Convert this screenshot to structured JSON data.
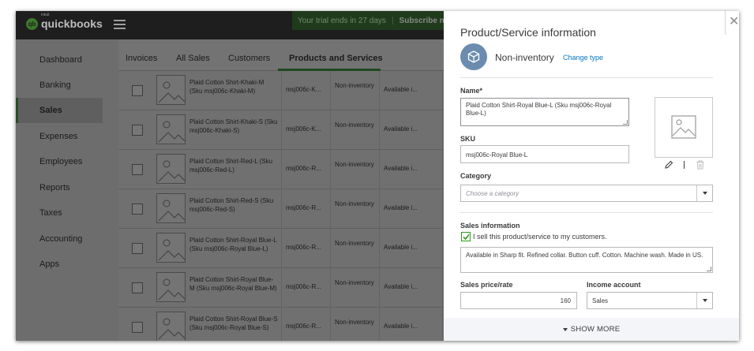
{
  "header": {
    "logo_small": "intuit",
    "logo_text": "quickbooks",
    "trial_text": "Your trial ends in 27 days",
    "subscribe": "Subscribe now"
  },
  "sidebar": {
    "items": [
      {
        "label": "Dashboard"
      },
      {
        "label": "Banking"
      },
      {
        "label": "Sales",
        "active": true
      },
      {
        "label": "Expenses"
      },
      {
        "label": "Employees"
      },
      {
        "label": "Reports"
      },
      {
        "label": "Taxes"
      },
      {
        "label": "Accounting"
      },
      {
        "label": "Apps"
      }
    ]
  },
  "tabs": [
    "Invoices",
    "All Sales",
    "Customers",
    "Products and Services"
  ],
  "products": [
    {
      "name": "Plaid Cotton Shirt-Khaki-M (Sku msj006c-Khaki-M)",
      "sku": "msj006c-K...",
      "type": "Non-inventory",
      "avail": "Available i..."
    },
    {
      "name": "Plaid Cotton Shirt-Khaki-S (Sku msj006c-Khaki-S)",
      "sku": "msj006c-K...",
      "type": "Non-inventory",
      "avail": "Available i..."
    },
    {
      "name": "Plaid Cotton Shirt-Red-L (Sku msj006c-Red-L)",
      "sku": "msj006c-R...",
      "type": "Non-inventory",
      "avail": "Available i..."
    },
    {
      "name": "Plaid Cotton Shirt-Red-S (Sku msj006c-Red-S)",
      "sku": "msj006c-R...",
      "type": "Non-inventory",
      "avail": "Available i..."
    },
    {
      "name": "Plaid Cotton Shirt-Royal Blue-L (Sku msj006c-Royal Blue-L)",
      "sku": "msj006c-R...",
      "type": "Non-inventory",
      "avail": "Available i..."
    },
    {
      "name": "Plaid Cotton Shirt-Royal Blue-M (Sku msj006c-Royal Blue-M)",
      "sku": "msj006c-R...",
      "type": "Non-inventory",
      "avail": "Available i..."
    },
    {
      "name": "Plaid Cotton Shirt-Royal Blue-S (Sku msj006c-Royal Blue-S)",
      "sku": "msj006c-R...",
      "type": "Non-inventory",
      "avail": "Available i..."
    }
  ],
  "panel": {
    "title": "Product/Service information",
    "type_label": "Non-inventory",
    "change_type": "Change type",
    "name_label": "Name*",
    "name_value": "Plaid Cotton Shirt-Royal Blue-L (Sku msj006c-Royal Blue-L)",
    "sku_label": "SKU",
    "sku_value": "msj006c-Royal Blue-L",
    "category_label": "Category",
    "category_placeholder": "Choose a category",
    "sales_info_label": "Sales information",
    "sell_checkbox_label": "I sell this product/service to my customers.",
    "sell_checked": true,
    "description": "Available in Sharp fit. Refined collar. Button cuff. Cotton. Machine wash. Made in US.",
    "price_label": "Sales price/rate",
    "price_value": "160",
    "income_label": "Income account",
    "income_value": "Sales",
    "show_more": "SHOW MORE"
  },
  "colors": {
    "accent_green": "#2ca01c",
    "link_blue": "#0077c5",
    "type_circle": "#6b8cae"
  }
}
